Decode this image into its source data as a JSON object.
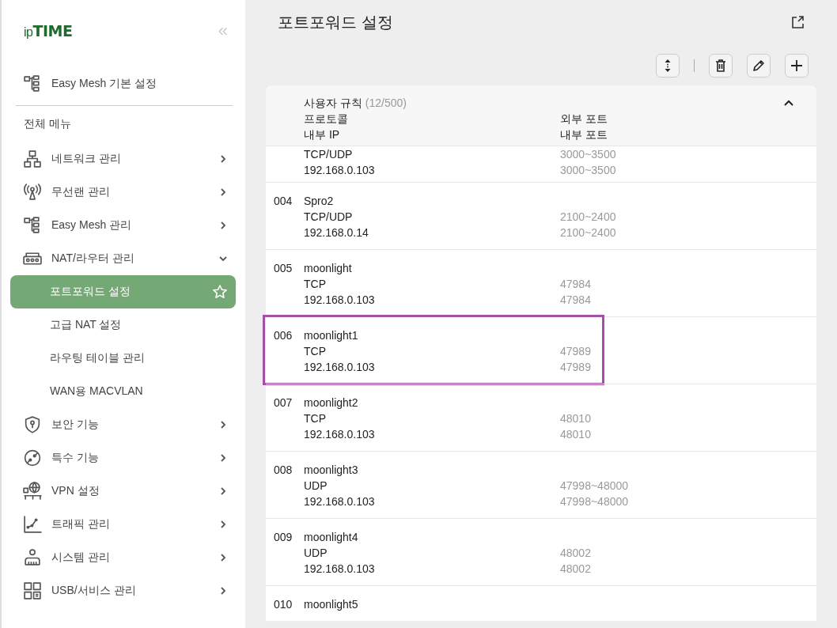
{
  "sidebar": {
    "logo": {
      "prefix": "ip",
      "name": "TIME"
    },
    "collapse": "«",
    "pinned": [
      {
        "kind": "mesh",
        "label": "Easy Mesh 기본 설정"
      }
    ],
    "section_title": "전체 메뉴",
    "menu": [
      {
        "kind": "network",
        "label": "네트워크 관리",
        "expanded": false
      },
      {
        "kind": "wireless",
        "label": "무선랜 관리",
        "expanded": false
      },
      {
        "kind": "mesh",
        "label": "Easy Mesh 관리",
        "expanded": false
      },
      {
        "kind": "router",
        "label": "NAT/라우터 관리",
        "expanded": true,
        "children": [
          {
            "label": "포트포워드 설정",
            "selected": true
          },
          {
            "label": "고급 NAT 설정",
            "selected": false
          },
          {
            "label": "라우팅 테이블 관리",
            "selected": false
          },
          {
            "label": "WAN용 MACVLAN",
            "selected": false
          }
        ]
      },
      {
        "kind": "shield",
        "label": "보안 기능",
        "expanded": false
      },
      {
        "kind": "gauge",
        "label": "특수 기능",
        "expanded": false
      },
      {
        "kind": "vpn",
        "label": "VPN 설정",
        "expanded": false
      },
      {
        "kind": "traffic",
        "label": "트래픽 관리",
        "expanded": false
      },
      {
        "kind": "system",
        "label": "시스템 관리",
        "expanded": false
      },
      {
        "kind": "usb",
        "label": "USB/서비스 관리",
        "expanded": false
      }
    ]
  },
  "main": {
    "title": "포트포워드 설정",
    "toolbar": [
      {
        "kind": "sort"
      },
      {
        "kind": "delete"
      },
      {
        "kind": "edit"
      },
      {
        "kind": "add"
      }
    ],
    "table": {
      "group_title": "사용자 규칙",
      "count": "(12/500)",
      "expanded": true,
      "columns": [
        "프로토콜",
        "내부 IP",
        "외부 포트",
        "내부 포트"
      ],
      "rows": [
        {
          "protocol": "TCP/UDP",
          "internal_ip": "192.168.0.103",
          "external_port": "3000~3500",
          "internal_port": "3000~3500",
          "highlighted": false
        },
        {
          "number": "004",
          "name": "Spro2",
          "protocol": "TCP/UDP",
          "internal_ip": "192.168.0.14",
          "external_port": "2100~2400",
          "internal_port": "2100~2400",
          "highlighted": false
        },
        {
          "number": "005",
          "name": "moonlight",
          "protocol": "TCP",
          "internal_ip": "192.168.0.103",
          "external_port": "47984",
          "internal_port": "47984",
          "highlighted": false
        },
        {
          "number": "006",
          "name": "moonlight1",
          "protocol": "TCP",
          "internal_ip": "192.168.0.103",
          "external_port": "47989",
          "internal_port": "47989",
          "highlighted": true
        },
        {
          "number": "007",
          "name": "moonlight2",
          "protocol": "TCP",
          "internal_ip": "192.168.0.103",
          "external_port": "48010",
          "internal_port": "48010",
          "highlighted": false
        },
        {
          "number": "008",
          "name": "moonlight3",
          "protocol": "UDP",
          "internal_ip": "192.168.0.103",
          "external_port": "47998~48000",
          "internal_port": "47998~48000",
          "highlighted": false
        },
        {
          "number": "009",
          "name": "moonlight4",
          "protocol": "UDP",
          "internal_ip": "192.168.0.103",
          "external_port": "48002",
          "internal_port": "48002",
          "highlighted": false
        },
        {
          "number": "010",
          "name": "moonlight5",
          "highlighted": false
        }
      ]
    }
  }
}
